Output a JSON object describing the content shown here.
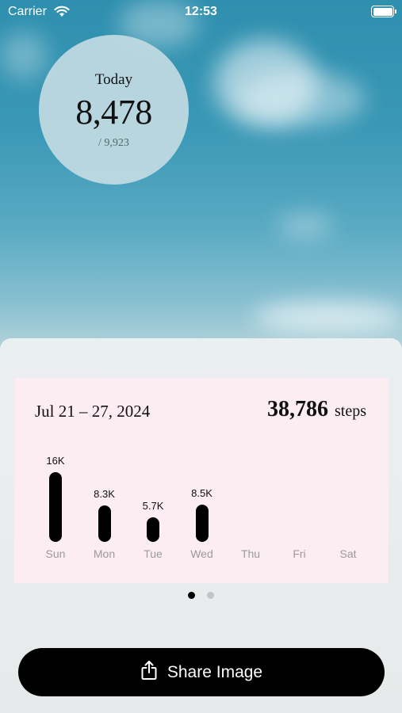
{
  "status_bar": {
    "carrier": "Carrier",
    "time": "12:53",
    "wifi_icon": "wifi-icon",
    "battery_icon": "battery-icon"
  },
  "today": {
    "label": "Today",
    "steps": "8,478",
    "goal": "/ 9,923"
  },
  "week": {
    "range": "Jul 21 – 27, 2024",
    "total": "38,786",
    "unit": "steps"
  },
  "chart_data": {
    "type": "bar",
    "categories": [
      "Sun",
      "Mon",
      "Tue",
      "Wed",
      "Thu",
      "Fri",
      "Sat"
    ],
    "values": [
      16000,
      8300,
      5700,
      8500,
      null,
      null,
      null
    ],
    "value_labels": [
      "16K",
      "8.3K",
      "5.7K",
      "8.5K",
      "",
      "",
      ""
    ],
    "bar_color": "#000000",
    "label_color": "#9a9a9e"
  },
  "pager": {
    "count": 2,
    "active": 0,
    "active_color": "#000000",
    "inactive_color": "#c4c4c6"
  },
  "share_button": {
    "label": "Share Image",
    "icon": "share-icon"
  },
  "colors": {
    "card_background": "#fcedf2",
    "button_background": "#000000"
  }
}
